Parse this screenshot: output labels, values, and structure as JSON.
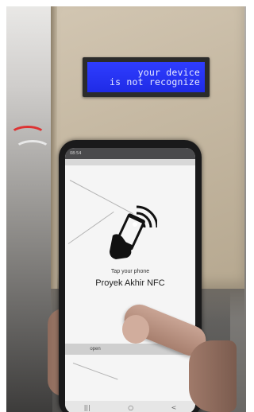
{
  "lcd": {
    "line1": "your device",
    "line2": "is not recognize"
  },
  "phone": {
    "status_time": "08:54",
    "tap_text": "Tap your phone",
    "app_title": "Proyek Akhir NFC",
    "open_label": "open",
    "nav": [
      "|||",
      "○",
      "<"
    ],
    "icon": "nfc-tap-phone-icon"
  }
}
